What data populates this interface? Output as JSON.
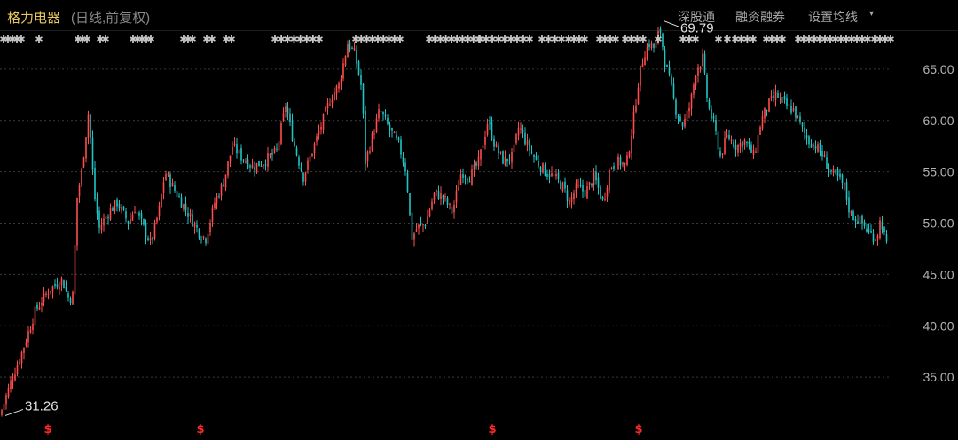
{
  "header": {
    "title": "格力电器",
    "subtitle": "(日线,前复权)",
    "menu": [
      "深股通",
      "融资融券",
      "设置均线"
    ],
    "caret": "▾"
  },
  "colors": {
    "up": "#ff4d4d",
    "down": "#20c4c4",
    "grid": "#3a3a3a",
    "event": "#ff2a2a"
  },
  "chart_data": {
    "type": "candlestick",
    "ylim": [
      30,
      70
    ],
    "yticks": [
      35,
      40,
      45,
      50,
      55,
      60,
      65
    ],
    "ytick_labels": [
      "35.00",
      "40.00",
      "45.00",
      "50.00",
      "55.00",
      "60.00",
      "65.00"
    ],
    "annotations": [
      {
        "label": "69.79",
        "value": 69.79
      },
      {
        "label": "31.26",
        "value": 31.26
      }
    ],
    "event_marker_glyph": "$",
    "event_marker_count": 4,
    "top_marker_glyph": "✱",
    "anchors": [
      [
        0,
        31.3
      ],
      [
        12,
        34.5
      ],
      [
        25,
        37.5
      ],
      [
        40,
        41.5
      ],
      [
        55,
        43.5
      ],
      [
        70,
        44.5
      ],
      [
        78,
        42.5
      ],
      [
        82,
        43.0
      ],
      [
        84,
        44.0
      ],
      [
        85,
        51.5
      ],
      [
        92,
        55.0
      ],
      [
        100,
        61.0
      ],
      [
        106,
        53.0
      ],
      [
        112,
        49.5
      ],
      [
        122,
        51.0
      ],
      [
        132,
        52.0
      ],
      [
        145,
        50.0
      ],
      [
        152,
        51.5
      ],
      [
        162,
        49.5
      ],
      [
        170,
        48.0
      ],
      [
        180,
        51.5
      ],
      [
        186,
        55.0
      ],
      [
        195,
        53.5
      ],
      [
        205,
        52.0
      ],
      [
        215,
        50.5
      ],
      [
        225,
        49.0
      ],
      [
        232,
        48.5
      ],
      [
        242,
        52.0
      ],
      [
        252,
        54.0
      ],
      [
        262,
        57.5
      ],
      [
        272,
        56.5
      ],
      [
        285,
        55.5
      ],
      [
        298,
        56.0
      ],
      [
        312,
        57.0
      ],
      [
        322,
        61.5
      ],
      [
        332,
        57.5
      ],
      [
        342,
        54.5
      ],
      [
        350,
        56.5
      ],
      [
        362,
        59.5
      ],
      [
        372,
        62.0
      ],
      [
        382,
        63.5
      ],
      [
        392,
        67.5
      ],
      [
        400,
        66.5
      ],
      [
        408,
        63.0
      ],
      [
        412,
        56.0
      ],
      [
        420,
        58.5
      ],
      [
        428,
        61.0
      ],
      [
        440,
        59.0
      ],
      [
        450,
        57.5
      ],
      [
        458,
        55.0
      ],
      [
        464,
        48.5
      ],
      [
        470,
        49.5
      ],
      [
        480,
        50.0
      ],
      [
        490,
        53.0
      ],
      [
        500,
        52.5
      ],
      [
        510,
        51.0
      ],
      [
        520,
        55.0
      ],
      [
        530,
        54.5
      ],
      [
        540,
        56.0
      ],
      [
        550,
        60.0
      ],
      [
        558,
        57.5
      ],
      [
        568,
        56.0
      ],
      [
        578,
        56.5
      ],
      [
        585,
        59.5
      ],
      [
        595,
        57.5
      ],
      [
        605,
        56.0
      ],
      [
        615,
        55.0
      ],
      [
        625,
        54.5
      ],
      [
        635,
        53.5
      ],
      [
        642,
        52.0
      ],
      [
        650,
        53.5
      ],
      [
        660,
        53.0
      ],
      [
        670,
        54.5
      ],
      [
        680,
        52.0
      ],
      [
        688,
        55.5
      ],
      [
        698,
        56.0
      ],
      [
        706,
        55.5
      ],
      [
        714,
        60.0
      ],
      [
        720,
        64.0
      ],
      [
        726,
        66.5
      ],
      [
        732,
        67.5
      ],
      [
        738,
        67.0
      ],
      [
        744,
        69.0
      ],
      [
        750,
        65.5
      ],
      [
        756,
        63.5
      ],
      [
        762,
        61.0
      ],
      [
        770,
        59.5
      ],
      [
        778,
        61.5
      ],
      [
        785,
        65.0
      ],
      [
        792,
        66.0
      ],
      [
        798,
        61.5
      ],
      [
        805,
        59.5
      ],
      [
        812,
        56.5
      ],
      [
        820,
        58.5
      ],
      [
        830,
        57.5
      ],
      [
        840,
        58.0
      ],
      [
        850,
        56.5
      ],
      [
        858,
        60.0
      ],
      [
        866,
        61.5
      ],
      [
        875,
        62.5
      ],
      [
        885,
        61.5
      ],
      [
        895,
        61.0
      ],
      [
        905,
        59.0
      ],
      [
        912,
        58.0
      ],
      [
        920,
        57.5
      ],
      [
        928,
        56.5
      ],
      [
        936,
        55.0
      ],
      [
        944,
        54.5
      ],
      [
        952,
        53.5
      ],
      [
        958,
        51.0
      ],
      [
        964,
        50.5
      ],
      [
        972,
        50.0
      ],
      [
        980,
        49.0
      ],
      [
        988,
        48.5
      ],
      [
        993,
        50.5
      ],
      [
        1000,
        47.5
      ]
    ]
  }
}
